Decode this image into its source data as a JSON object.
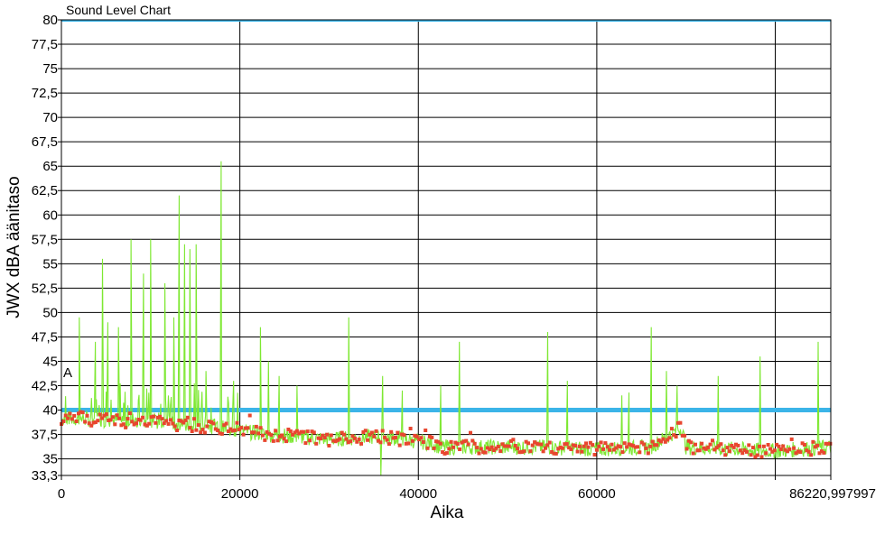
{
  "window": {
    "title": "Sound Level Chart"
  },
  "chart_data": {
    "type": "line",
    "title": "Sound Level Chart",
    "xlabel": "Aika",
    "ylabel": "JWX dBA äänitaso",
    "xlim": [
      0,
      86220.997997
    ],
    "ylim": [
      33.3,
      80
    ],
    "x_ticks": [
      0,
      20000,
      40000,
      60000,
      86220.997997
    ],
    "x_tick_labels": [
      "0",
      "20000",
      "40000",
      "60000",
      "86220,997997"
    ],
    "extra_vertical_grid_x": [
      80000
    ],
    "y_ticks": [
      33.3,
      35,
      37.5,
      40,
      42.5,
      45,
      47.5,
      50,
      52.5,
      55,
      57.5,
      60,
      62.5,
      65,
      67.5,
      70,
      72.5,
      75,
      77.5,
      80
    ],
    "y_tick_labels": [
      "33,3",
      "35",
      "37,5",
      "40",
      "42,5",
      "45",
      "47,5",
      "50",
      "52,5",
      "55",
      "57,5",
      "60",
      "62,5",
      "65",
      "67,5",
      "70",
      "72,5",
      "75",
      "77,5",
      "80"
    ],
    "marker_label": {
      "text": "A",
      "y": 42.5
    },
    "reference_line": {
      "y": 40,
      "color": "#3bb4e8"
    },
    "top_line": {
      "y": 80,
      "color": "#3bb4e8"
    },
    "grid": true,
    "series": [
      {
        "style": "line",
        "color": "#7ee832",
        "spikes": [
          {
            "x": 2000,
            "y": 49.5
          },
          {
            "x": 3800,
            "y": 47
          },
          {
            "x": 4600,
            "y": 55.5
          },
          {
            "x": 5200,
            "y": 49
          },
          {
            "x": 6400,
            "y": 48.5
          },
          {
            "x": 7800,
            "y": 57.5
          },
          {
            "x": 9200,
            "y": 54
          },
          {
            "x": 10000,
            "y": 57.5
          },
          {
            "x": 11600,
            "y": 53
          },
          {
            "x": 12600,
            "y": 49.5
          },
          {
            "x": 13200,
            "y": 62
          },
          {
            "x": 13800,
            "y": 57
          },
          {
            "x": 14400,
            "y": 56.5
          },
          {
            "x": 15100,
            "y": 57
          },
          {
            "x": 16200,
            "y": 44
          },
          {
            "x": 17900,
            "y": 65.5
          },
          {
            "x": 19300,
            "y": 43
          },
          {
            "x": 22300,
            "y": 48.5
          },
          {
            "x": 23200,
            "y": 45
          },
          {
            "x": 24400,
            "y": 43.5
          },
          {
            "x": 26400,
            "y": 42.5
          },
          {
            "x": 32200,
            "y": 49.5
          },
          {
            "x": 36000,
            "y": 43.5
          },
          {
            "x": 38200,
            "y": 42
          },
          {
            "x": 42500,
            "y": 42.5
          },
          {
            "x": 44600,
            "y": 47
          },
          {
            "x": 54500,
            "y": 48
          },
          {
            "x": 56700,
            "y": 43
          },
          {
            "x": 62800,
            "y": 41.5
          },
          {
            "x": 63600,
            "y": 41.8
          },
          {
            "x": 66100,
            "y": 48.5
          },
          {
            "x": 67800,
            "y": 44
          },
          {
            "x": 69000,
            "y": 42.5
          },
          {
            "x": 73600,
            "y": 43.5
          },
          {
            "x": 78300,
            "y": 45.5
          },
          {
            "x": 84800,
            "y": 47
          }
        ],
        "dips": [
          {
            "x": 35800,
            "y": 33.3
          }
        ],
        "baseline": [
          {
            "x": 0,
            "y": 39.2
          },
          {
            "x": 10000,
            "y": 38.8
          },
          {
            "x": 17000,
            "y": 38.3
          },
          {
            "x": 22000,
            "y": 37.6
          },
          {
            "x": 30000,
            "y": 37.0
          },
          {
            "x": 36000,
            "y": 37.3
          },
          {
            "x": 41500,
            "y": 36.6
          },
          {
            "x": 42500,
            "y": 36.2
          },
          {
            "x": 55000,
            "y": 36.2
          },
          {
            "x": 60000,
            "y": 36.0
          },
          {
            "x": 66000,
            "y": 36.2
          },
          {
            "x": 69500,
            "y": 38.2
          },
          {
            "x": 70000,
            "y": 36.2
          },
          {
            "x": 80000,
            "y": 35.8
          },
          {
            "x": 86221,
            "y": 36.2
          }
        ]
      },
      {
        "style": "markers",
        "color": "#e8462f",
        "baseline": [
          {
            "x": 0,
            "y": 39.2
          },
          {
            "x": 10000,
            "y": 38.8
          },
          {
            "x": 17000,
            "y": 38.3
          },
          {
            "x": 22000,
            "y": 37.6
          },
          {
            "x": 30000,
            "y": 37.0
          },
          {
            "x": 36000,
            "y": 37.3
          },
          {
            "x": 41500,
            "y": 36.6
          },
          {
            "x": 42500,
            "y": 36.2
          },
          {
            "x": 55000,
            "y": 36.2
          },
          {
            "x": 60000,
            "y": 36.0
          },
          {
            "x": 66000,
            "y": 36.2
          },
          {
            "x": 69500,
            "y": 38.2
          },
          {
            "x": 70000,
            "y": 36.2
          },
          {
            "x": 80000,
            "y": 35.8
          },
          {
            "x": 86221,
            "y": 36.2
          }
        ]
      }
    ]
  }
}
